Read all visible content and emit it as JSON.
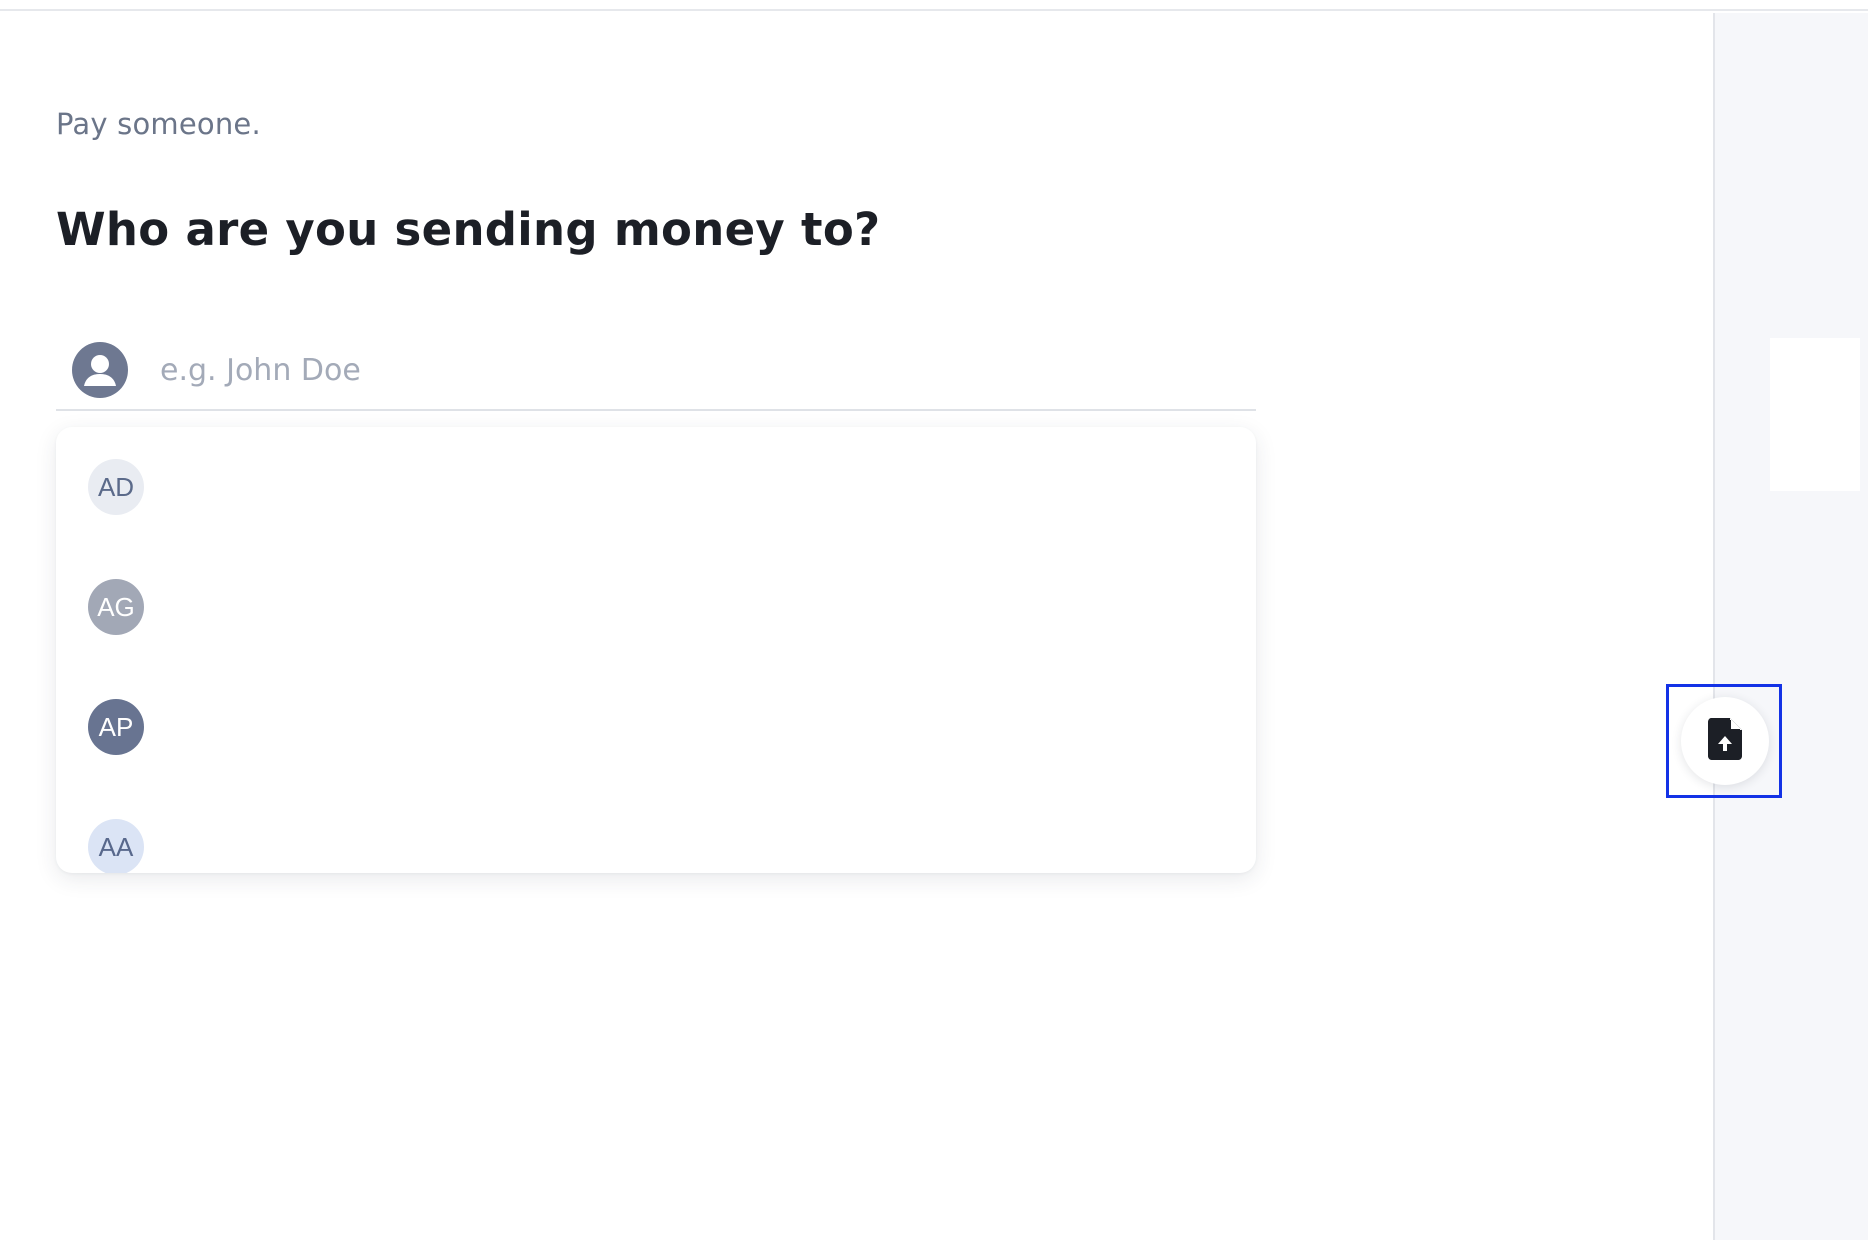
{
  "page": {
    "subtitle": "Pay someone.",
    "heading": "Who are you sending money to?"
  },
  "search": {
    "placeholder": "e.g. John Doe",
    "value": "",
    "icon": "user-circle-icon"
  },
  "suggestions": [
    {
      "initials": "AD",
      "bg": "#e9ecf2",
      "fg": "#5b6a8a"
    },
    {
      "initials": "AG",
      "bg": "#a2a8b6",
      "fg": "#ffffff"
    },
    {
      "initials": "AP",
      "bg": "#687491",
      "fg": "#ffffff"
    },
    {
      "initials": "AA",
      "bg": "#dbe4f5",
      "fg": "#58688c"
    }
  ],
  "fab": {
    "icon": "file-upload-icon",
    "highlight_color": "#1332e6"
  },
  "colors": {
    "heading": "#1c1f26",
    "subtitle": "#6b7589",
    "placeholder": "#a3aab8",
    "side_panel": "#f6f7fa"
  }
}
